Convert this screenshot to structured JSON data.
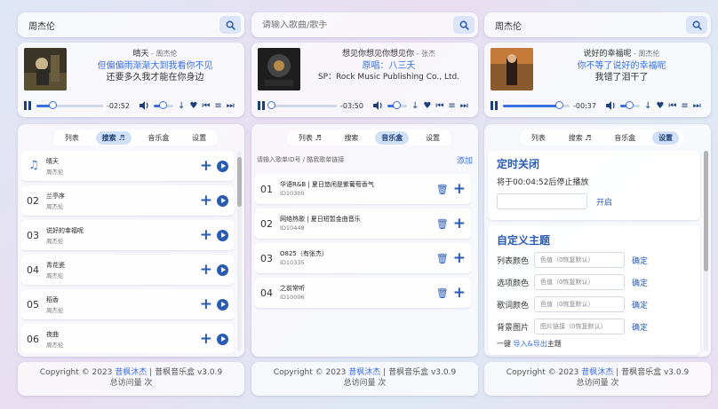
{
  "panels": [
    {
      "search": {
        "value": "周杰伦",
        "placeholder": ""
      },
      "player": {
        "title": "晴天",
        "artist": "周杰伦",
        "lyric1": "但偏偏雨渐渐大到我看你不见",
        "lyric2": "还要多久我才能在你身边",
        "time": "-02:52",
        "progress": 0.25,
        "volume": 0.5
      },
      "tabs": [
        "列表",
        "搜索",
        "音乐盒",
        "设置"
      ],
      "active_tab": 1,
      "rows": [
        {
          "num": "",
          "name": "晴天",
          "artist": "周杰伦",
          "playing": true
        },
        {
          "num": "02",
          "name": "兰亭序",
          "artist": "周杰伦"
        },
        {
          "num": "03",
          "name": "说好的幸福呢",
          "artist": "周杰伦"
        },
        {
          "num": "04",
          "name": "青花瓷",
          "artist": "周杰伦"
        },
        {
          "num": "05",
          "name": "稻香",
          "artist": "周杰伦"
        },
        {
          "num": "06",
          "name": "夜曲",
          "artist": "周杰伦"
        }
      ],
      "scroll_top": 0.03,
      "scroll_size": 0.25
    },
    {
      "search": {
        "value": "",
        "placeholder": "请输入歌曲/歌手"
      },
      "player": {
        "title": "想见你想见你想见你",
        "artist": "张杰",
        "lyric1": "原唱：八三夭",
        "lyric2": "SP：Rock Music Publishing Co., Ltd.",
        "time": "-03:50",
        "progress": 0.02,
        "volume": 0.5
      },
      "tabs": [
        "列表",
        "搜索",
        "音乐盒",
        "设置"
      ],
      "active_tab": 2,
      "add": {
        "placeholder": "请输入歌单ID号 / 酷我歌单链接",
        "label": "添加"
      },
      "rows": [
        {
          "num": "01",
          "name": "华语R&B | 夏日悠闲是紫葡萄香气",
          "artist": "ID10300"
        },
        {
          "num": "02",
          "name": "网络热歌 | 夏日短暂金曲音乐",
          "artist": "ID10448"
        },
        {
          "num": "03",
          "name": "O825（有张杰）",
          "artist": "ID10335"
        },
        {
          "num": "04",
          "name": "之前常听",
          "artist": "ID10006"
        }
      ]
    },
    {
      "search": {
        "value": "周杰伦",
        "placeholder": ""
      },
      "player": {
        "title": "说好的幸福呢",
        "artist": "周杰伦",
        "lyric1": "你不等了说好的幸福呢",
        "lyric2": "我错了泪干了",
        "time": "-00:37",
        "progress": 0.85,
        "volume": 0.5
      },
      "tabs": [
        "列表",
        "搜索",
        "音乐盒",
        "设置"
      ],
      "active_tab": 3,
      "timer": {
        "title": "定时关闭",
        "text": "将于00:04:52后停止播放",
        "placeholder": "",
        "button": "开启"
      },
      "theme": {
        "title": "自定义主题",
        "items": [
          {
            "label": "列表颜色",
            "placeholder": "色值（0恢复默认）",
            "ok": "确定"
          },
          {
            "label": "选项颜色",
            "placeholder": "色值（0恢复默认）",
            "ok": "确定"
          },
          {
            "label": "歌词颜色",
            "placeholder": "色值（0恢复默认）",
            "ok": "确定"
          },
          {
            "label": "背景图片",
            "placeholder": "图片链接（0恢复默认）",
            "ok": "确定"
          }
        ],
        "io_prefix": "一键",
        "io_link": "导入&导出",
        "io_suffix": "主题"
      },
      "scroll_top": 0.0,
      "scroll_size": 0.6
    }
  ],
  "footer": {
    "copyright": "Copyright © 2023",
    "author": "昔枫沐杰",
    "sep": "|",
    "app": "昔枫音乐盒 v3.0.9",
    "visits": "总访问量 次"
  },
  "colors": {
    "accent": "#3c6fe0",
    "icon": "#2a5bb0"
  }
}
